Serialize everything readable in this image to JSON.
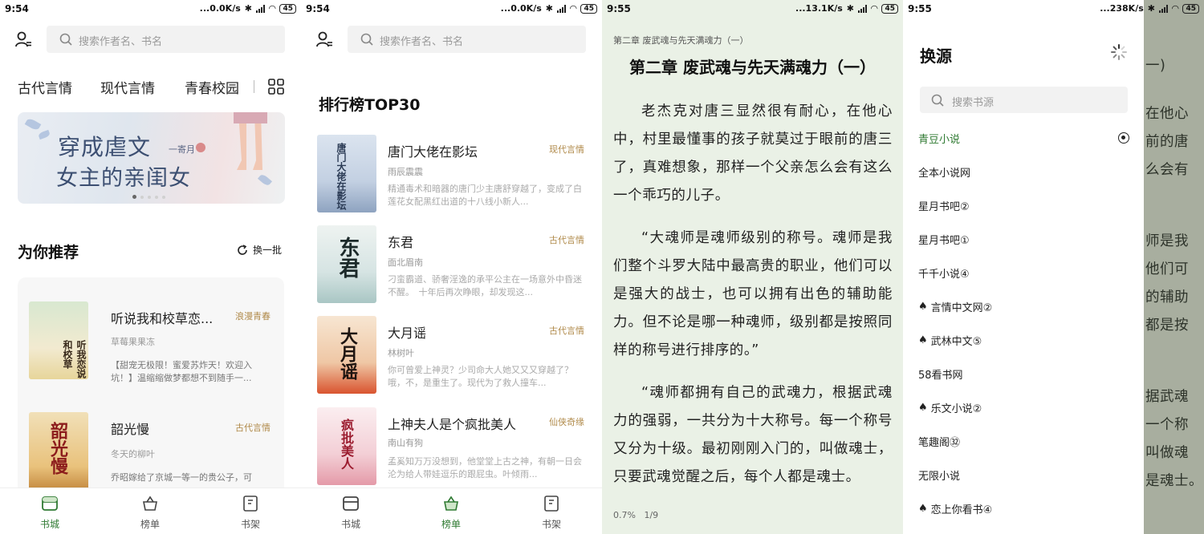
{
  "panel1": {
    "status": {
      "time": "9:54",
      "speed": "...0.0K/s",
      "battery": "45"
    },
    "search_placeholder": "搜索作者名、书名",
    "categories": [
      "古代言情",
      "现代言情",
      "青春校园"
    ],
    "banner": {
      "line1": "穿成虐文",
      "line2": "女主的亲闺女",
      "author": "一寄月"
    },
    "section_title": "为你推荐",
    "refresh_label": "换一批",
    "books": [
      {
        "title": "听说我和校草恋...",
        "tag": "浪漫青春",
        "author": "草莓果果冻",
        "desc": "【甜宠无极限！蜜爱苏炸天！欢迎入坑！】温缩缩做梦都想不到随手一...",
        "cover_text": "听我恋说和校草"
      },
      {
        "title": "韶光慢",
        "tag": "古代言情",
        "author": "冬天的柳叶",
        "desc": "乔昭嫁给了京城一等一的贵公子，可",
        "cover_text": "韶光慢"
      }
    ],
    "tabs": [
      {
        "label": "书城",
        "icon": "store-icon"
      },
      {
        "label": "榜单",
        "icon": "basket-icon"
      },
      {
        "label": "书架",
        "icon": "bookshelf-icon"
      }
    ]
  },
  "panel2": {
    "status": {
      "time": "9:54",
      "speed": "...0.0K/s",
      "battery": "45"
    },
    "search_placeholder": "搜索作者名、书名",
    "rank_title": "排行榜TOP30",
    "books": [
      {
        "title": "唐门大佬在影坛",
        "tag": "现代言情",
        "author": "雨辰震震",
        "desc": "精通毒术和暗器的唐门少主唐舒穿越了，变成了白莲花女配黑红出道的十八线小新人...",
        "cover_text": "唐门大佬在影坛"
      },
      {
        "title": "东君",
        "tag": "古代言情",
        "author": "面北眉南",
        "desc": "刁蛮霸道、骄奢淫逸的承平公主在一场意外中昏迷不醒。　十年后再次睁眼，却发现这...",
        "cover_text": "东君"
      },
      {
        "title": "大月谣",
        "tag": "古代言情",
        "author": "林树叶",
        "desc": "你可曾爱上神灵？少司命大人她又又又穿越了？哦，不，是重生了。现代为了救人撞车...",
        "cover_text": "大月谣"
      },
      {
        "title": "上神夫人是个疯批美人",
        "tag": "仙侠奇缘",
        "author": "南山有狗",
        "desc": "孟奚知万万没想到，他堂堂上古之神，有朝一日会沦为给人带娃逗乐的跟屁虫。叶倾雨...",
        "cover_text": "疯批美人"
      }
    ],
    "tabs": [
      {
        "label": "书城",
        "icon": "store-icon"
      },
      {
        "label": "榜单",
        "icon": "basket-icon"
      },
      {
        "label": "书架",
        "icon": "bookshelf-icon"
      }
    ]
  },
  "panel3": {
    "status": {
      "time": "9:55",
      "speed": "...13.1K/s",
      "battery": "45"
    },
    "header": "第二章 废武魂与先天满魂力（一）",
    "title": "第二章 废武魂与先天满魂力（一）",
    "paragraphs": [
      "老杰克对唐三显然很有耐心，在他心中，村里最懂事的孩子就莫过于眼前的唐三了，真难想象，那样一个父亲怎么会有这么一个乖巧的儿子。",
      "“大魂师是魂师级别的称号。魂师是我们整个斗罗大陆中最高贵的职业，他们可以是强大的战士，也可以拥有出色的辅助能力。但不论是哪一种魂师，级别都是按照同样的称号进行排序的。”",
      "“魂师都拥有自己的武魂力，根据武魂力的强弱，一共分为十大称号。每一个称号又分为十级。最初刚刚入门的，叫做魂士，只要武魂觉醒之后，每个人都是魂士。"
    ],
    "progress": "0.7%",
    "page": "1/9"
  },
  "panel4": {
    "status": {
      "time": "9:55",
      "speed": "...238K/s",
      "battery": "45"
    },
    "title": "换源",
    "search_placeholder": "搜索书源",
    "sources": [
      {
        "name": "青豆小说",
        "spade": false,
        "selected": true
      },
      {
        "name": "全本小说网",
        "spade": false,
        "selected": false
      },
      {
        "name": "星月书吧②",
        "spade": false,
        "selected": false
      },
      {
        "name": "星月书吧①",
        "spade": false,
        "selected": false
      },
      {
        "name": "千千小说④",
        "spade": false,
        "selected": false
      },
      {
        "name": "言情中文网②",
        "spade": true,
        "selected": false
      },
      {
        "name": "武林中文⑤",
        "spade": true,
        "selected": false
      },
      {
        "name": "58看书网",
        "spade": false,
        "selected": false
      },
      {
        "name": "乐文小说②",
        "spade": true,
        "selected": false
      },
      {
        "name": "笔趣阁㉜",
        "spade": false,
        "selected": false
      },
      {
        "name": "无限小说",
        "spade": false,
        "selected": false
      },
      {
        "name": "恋上你看书④",
        "spade": true,
        "selected": false
      }
    ],
    "background_lines": [
      "一)",
      "在他心",
      "前的唐",
      "么会有",
      "师是我",
      "他们可",
      "的辅助",
      "都是按",
      "据武魂",
      "一个称",
      "叫做魂",
      "是魂士。"
    ],
    "colors": {
      "accent": "#2f7a32",
      "tag": "#b08a4a",
      "reader_bg": "#eaf1e6"
    }
  }
}
